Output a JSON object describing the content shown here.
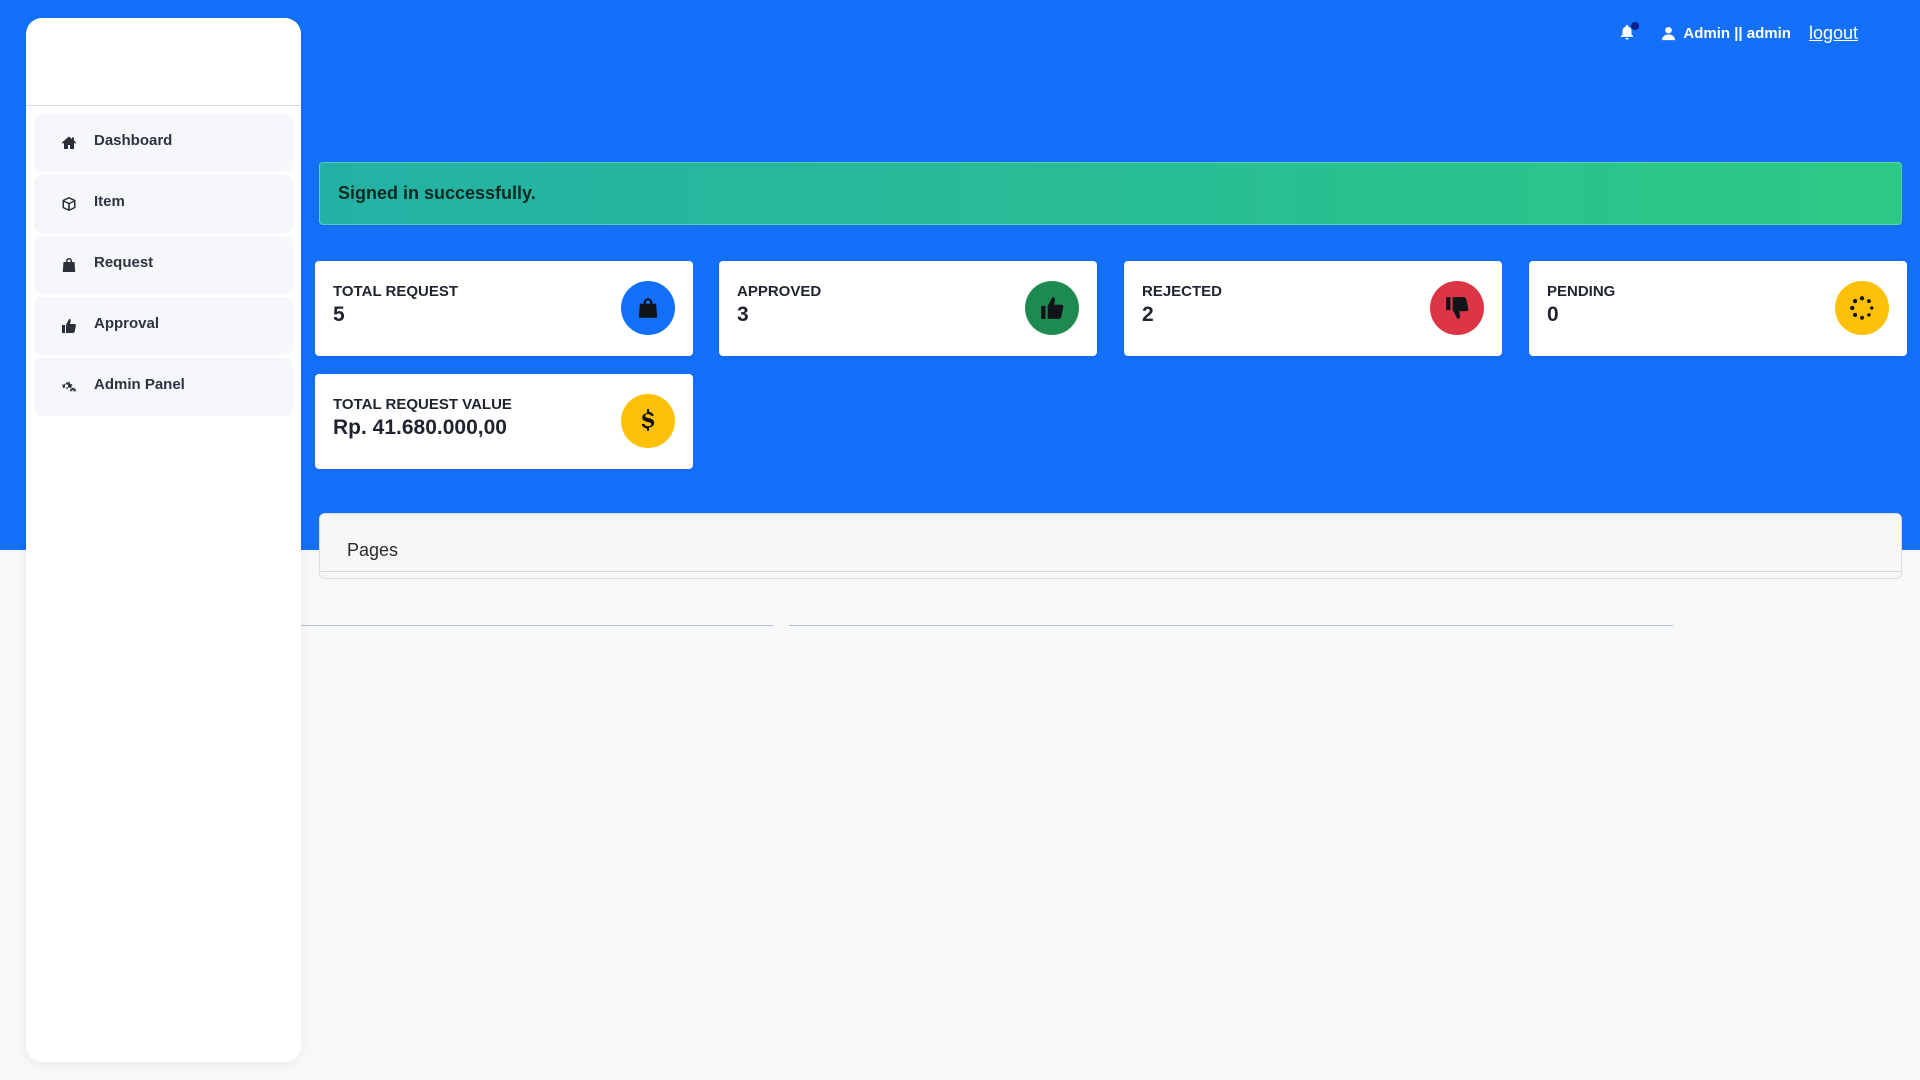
{
  "header": {
    "user_label": "Admin || admin",
    "logout_label": "logout"
  },
  "sidebar": {
    "items": [
      {
        "label": "Dashboard",
        "icon": "home-icon"
      },
      {
        "label": "Item",
        "icon": "box-icon"
      },
      {
        "label": "Request",
        "icon": "bag-icon"
      },
      {
        "label": "Approval",
        "icon": "thumbs-up-icon"
      },
      {
        "label": "Admin Panel",
        "icon": "cogs-icon"
      }
    ]
  },
  "alert": {
    "message": "Signed in successfully."
  },
  "stats": [
    {
      "title": "TOTAL REQUEST",
      "value": "5",
      "icon": "shopping-bag-icon",
      "color": "#1470f9"
    },
    {
      "title": "APPROVED",
      "value": "3",
      "icon": "thumbs-up-icon",
      "color": "#1d8a50"
    },
    {
      "title": "REJECTED",
      "value": "2",
      "icon": "thumbs-down-icon",
      "color": "#dc3545"
    },
    {
      "title": "PENDING",
      "value": "0",
      "icon": "spinner-icon",
      "color": "#ffc107"
    },
    {
      "title": "TOTAL REQUEST VALUE",
      "value": "Rp. 41.680.000,00",
      "icon": "dollar-icon",
      "color": "#ffc107"
    }
  ],
  "pages_panel": {
    "title": "Pages"
  },
  "colors": {
    "primary": "#1470f9",
    "success_gradient_start": "#24b1a5",
    "success_gradient_end": "#2cc985"
  }
}
